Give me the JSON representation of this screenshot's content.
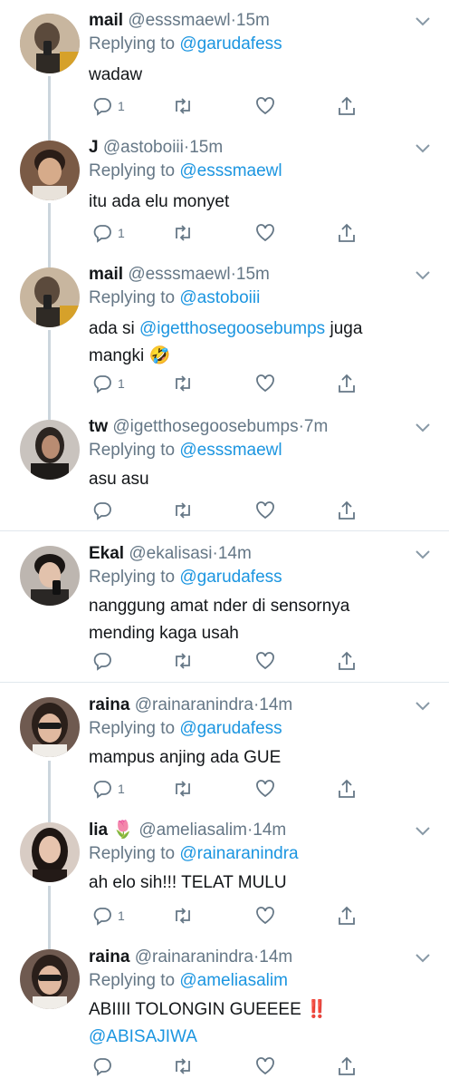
{
  "tweets": [
    {
      "name": "mail",
      "handle": "@esssmaewl",
      "dot": "·",
      "time": "15m",
      "replying": "Replying to",
      "to": "@garudafess",
      "text": "wadaw",
      "reply_count": "1",
      "avatar_bg": "#b9a58f"
    },
    {
      "name": "J",
      "handle": "@astoboiii",
      "dot": "·",
      "time": "15m",
      "replying": "Replying to",
      "to": "@esssmaewl",
      "text": "itu ada elu monyet",
      "reply_count": "1",
      "avatar_bg": "#6b5141"
    },
    {
      "name": "mail",
      "handle": "@esssmaewl",
      "dot": "·",
      "time": "15m",
      "replying": "Replying to",
      "to": "@astoboiii",
      "text_pre": "ada si ",
      "mention": "@igetthosegoosebumps",
      "text_post": " juga mangki 🤣",
      "reply_count": "1",
      "avatar_bg": "#b9a58f"
    },
    {
      "name": "tw",
      "handle": "@igetthosegoosebumps",
      "dot": "·",
      "time": "7m",
      "replying": "Replying to",
      "to": "@esssmaewl",
      "text": "asu asu",
      "reply_count": "",
      "avatar_bg": "#8d8680"
    },
    {
      "name": "Ekal",
      "handle": "@ekalisasi",
      "dot": "·",
      "time": "14m",
      "replying": "Replying to",
      "to": "@garudafess",
      "text": "nanggung amat nder di sensornya mending kaga usah",
      "reply_count": "",
      "avatar_bg": "#a39a94"
    },
    {
      "name": "raina",
      "handle": "@rainaranindra",
      "dot": "·",
      "time": "14m",
      "replying": "Replying to",
      "to": "@garudafess",
      "text": "mampus anjing ada GUE",
      "reply_count": "1",
      "avatar_bg": "#8a6f63"
    },
    {
      "name": "lia 🌷",
      "handle": "@ameliasalim",
      "dot": "·",
      "time": "14m",
      "replying": "Replying to",
      "to": "@rainaranindra",
      "text": "ah elo sih!!! TELAT MULU",
      "reply_count": "1",
      "avatar_bg": "#3d2e28"
    },
    {
      "name": "raina",
      "handle": "@rainaranindra",
      "dot": "·",
      "time": "14m",
      "replying": "Replying to",
      "to": "@ameliasalim",
      "text": "ABIIII TOLONGIN GUEEEE ‼️",
      "mention": "@ABISAJIWA",
      "reply_count": "",
      "avatar_bg": "#8a6f63"
    }
  ],
  "colors": {
    "link": "#1b95e0",
    "muted": "#657786",
    "line": "#ccd6dd",
    "text": "#14171a"
  },
  "icons": {
    "reply": "reply-icon",
    "retweet": "retweet-icon",
    "like": "heart-icon",
    "share": "share-icon",
    "caret": "chevron-down-icon"
  }
}
